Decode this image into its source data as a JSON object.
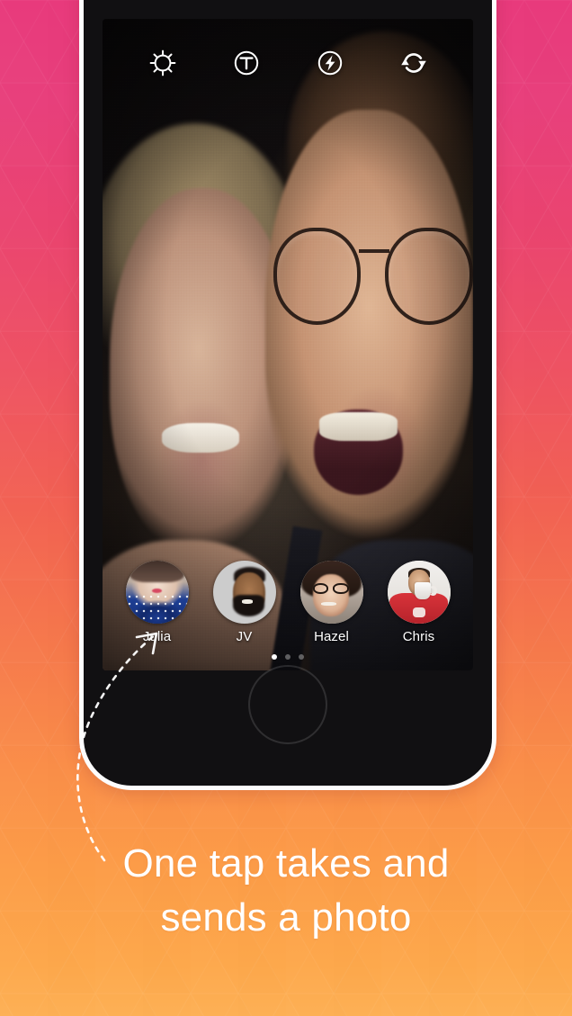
{
  "background": {
    "gradient_top": "#e83a7c",
    "gradient_mid": "#f26253",
    "gradient_bottom": "#fdb055",
    "pattern": "triangle-lattice"
  },
  "phone": {
    "frame_color": "#111012",
    "border_color": "#fdfdfd",
    "home_button": "home-button"
  },
  "camera": {
    "toolbar": [
      {
        "name": "brightness",
        "icon": "sun-icon",
        "label": "Brightness"
      },
      {
        "name": "text",
        "icon": "text-t-icon",
        "label": "Text"
      },
      {
        "name": "flash",
        "icon": "flash-icon",
        "label": "Flash"
      },
      {
        "name": "flip",
        "icon": "camera-flip-icon",
        "label": "Flip Camera"
      }
    ],
    "viewfinder_description": "Selfie of a smiling blonde woman and a laughing man wearing glasses in a dark room"
  },
  "contacts": {
    "items": [
      {
        "name": "Julia",
        "avatar": "julia-avatar"
      },
      {
        "name": "JV",
        "avatar": "jv-avatar"
      },
      {
        "name": "Hazel",
        "avatar": "hazel-avatar"
      },
      {
        "name": "Chris",
        "avatar": "chris-avatar"
      }
    ],
    "pagination": {
      "total": 3,
      "active_index": 0
    }
  },
  "annotation": {
    "arrow": "dashed-curved-arrow",
    "points_to": "Julia"
  },
  "caption": {
    "line1": "One tap takes and",
    "line2": "sends a photo",
    "color": "#ffffff"
  }
}
